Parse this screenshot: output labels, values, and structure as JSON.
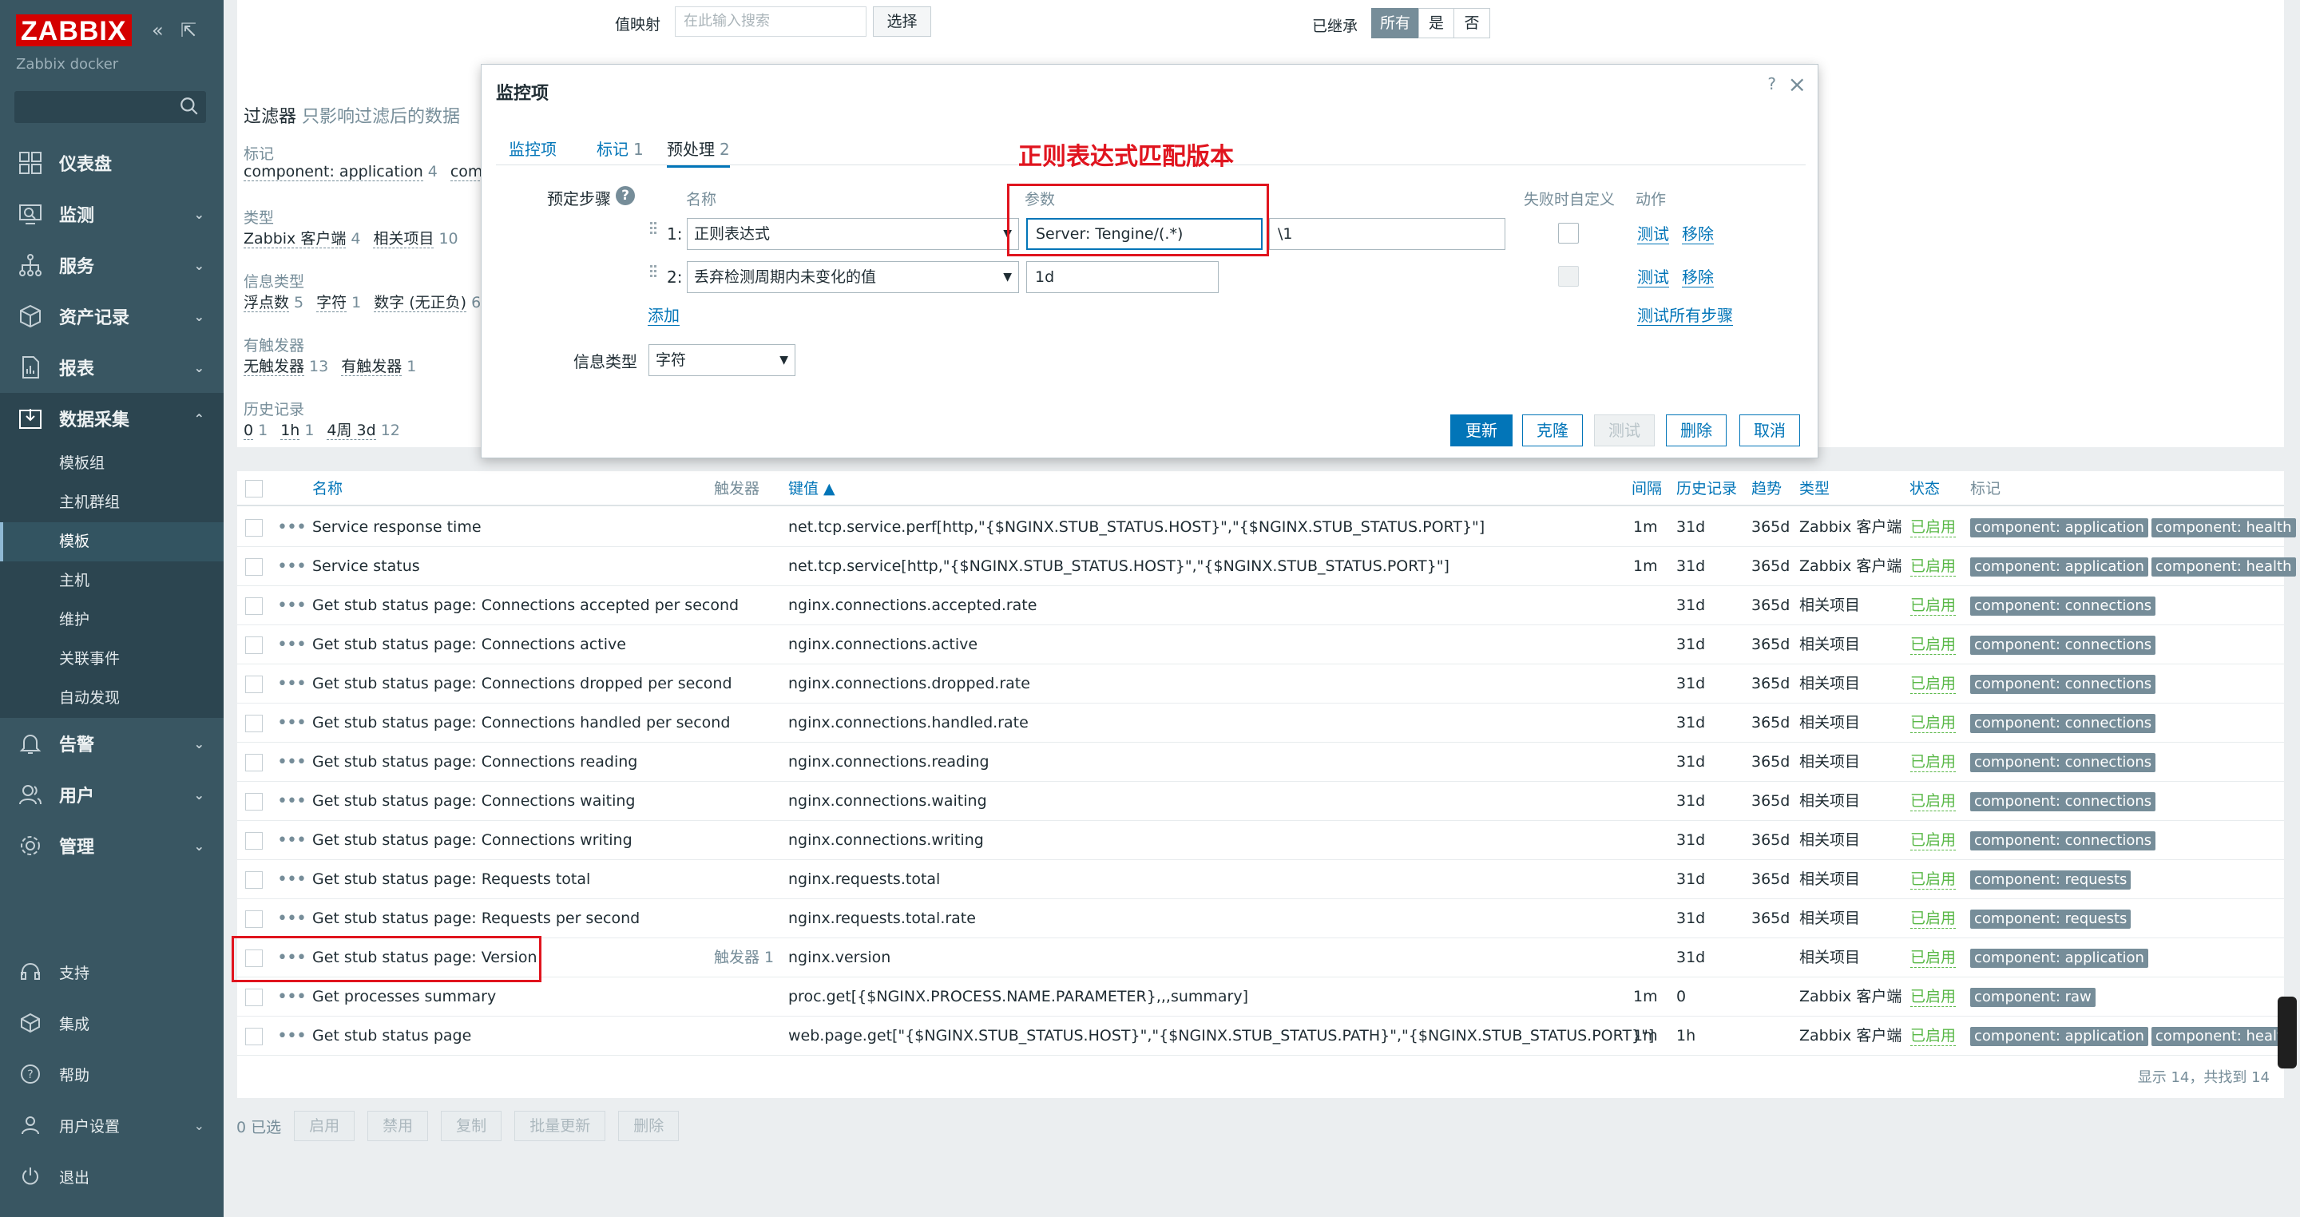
{
  "sidebar": {
    "logo": "ZABBIX",
    "instance": "Zabbix docker",
    "menu": [
      {
        "label": "仪表盘"
      },
      {
        "label": "监测"
      },
      {
        "label": "服务"
      },
      {
        "label": "资产记录"
      },
      {
        "label": "报表"
      },
      {
        "label": "数据采集"
      }
    ],
    "submenu": [
      "模板组",
      "主机群组",
      "模板",
      "主机",
      "维护",
      "关联事件",
      "自动发现"
    ],
    "menu2": [
      {
        "label": "告警"
      },
      {
        "label": "用户"
      },
      {
        "label": "管理"
      }
    ],
    "bottom": [
      {
        "label": "支持"
      },
      {
        "label": "集成"
      },
      {
        "label": "帮助"
      },
      {
        "label": "用户设置"
      },
      {
        "label": "退出"
      }
    ]
  },
  "filter": {
    "valuemap_label": "值映射",
    "valuemap_placeholder": "在此输入搜索",
    "select_btn": "选择",
    "inherited_label": "已继承",
    "inherited_options": [
      "所有",
      "是",
      "否"
    ],
    "title": "过滤器",
    "subtitle": "只影响过滤后的数据",
    "sections": [
      {
        "title": "标记",
        "values": [
          {
            "v": "component: application",
            "c": "4"
          },
          {
            "v": "compon",
            "c": ""
          }
        ]
      },
      {
        "title": "类型",
        "values": [
          {
            "v": "Zabbix 客户端",
            "c": "4"
          },
          {
            "v": "相关项目",
            "c": "10"
          }
        ]
      },
      {
        "title": "信息类型",
        "values": [
          {
            "v": "浮点数",
            "c": "5"
          },
          {
            "v": "字符",
            "c": "1"
          },
          {
            "v": "数字 (无正负)",
            "c": "6"
          }
        ]
      },
      {
        "title": "有触发器",
        "values": [
          {
            "v": "无触发器",
            "c": "13"
          },
          {
            "v": "有触发器",
            "c": "1"
          }
        ]
      },
      {
        "title": "历史记录",
        "values": [
          {
            "v": "0",
            "c": "1"
          },
          {
            "v": "1h",
            "c": "1"
          },
          {
            "v": "4周 3d",
            "c": "12"
          }
        ]
      }
    ]
  },
  "table": {
    "headers": {
      "name": "名称",
      "triggers": "触发器",
      "key": "键值 ▲",
      "interval": "间隔",
      "history": "历史记录",
      "trends": "趋势",
      "type": "类型",
      "status": "状态",
      "tags": "标记"
    },
    "rows": [
      {
        "name": "Service response time",
        "prefix": "",
        "triggers": "",
        "key": "net.tcp.service.perf[http,\"{$NGINX.STUB_STATUS.HOST}\",\"{$NGINX.STUB_STATUS.PORT}\"]",
        "interval": "1m",
        "history": "31d",
        "trends": "365d",
        "type": "Zabbix 客户端",
        "status": "已启用",
        "tags": [
          "component: application",
          "component: health"
        ]
      },
      {
        "name": "Service status",
        "prefix": "",
        "triggers": "",
        "key": "net.tcp.service[http,\"{$NGINX.STUB_STATUS.HOST}\",\"{$NGINX.STUB_STATUS.PORT}\"]",
        "interval": "1m",
        "history": "31d",
        "trends": "365d",
        "type": "Zabbix 客户端",
        "status": "已启用",
        "tags": [
          "component: application",
          "component: health"
        ]
      },
      {
        "name": "Connections accepted per second",
        "prefix": "Get stub status page: ",
        "triggers": "",
        "key": "nginx.connections.accepted.rate",
        "interval": "",
        "history": "31d",
        "trends": "365d",
        "type": "相关项目",
        "status": "已启用",
        "tags": [
          "component: connections"
        ]
      },
      {
        "name": "Connections active",
        "prefix": "Get stub status page: ",
        "triggers": "",
        "key": "nginx.connections.active",
        "interval": "",
        "history": "31d",
        "trends": "365d",
        "type": "相关项目",
        "status": "已启用",
        "tags": [
          "component: connections"
        ]
      },
      {
        "name": "Connections dropped per second",
        "prefix": "Get stub status page: ",
        "triggers": "",
        "key": "nginx.connections.dropped.rate",
        "interval": "",
        "history": "31d",
        "trends": "365d",
        "type": "相关项目",
        "status": "已启用",
        "tags": [
          "component: connections"
        ]
      },
      {
        "name": "Connections handled per second",
        "prefix": "Get stub status page: ",
        "triggers": "",
        "key": "nginx.connections.handled.rate",
        "interval": "",
        "history": "31d",
        "trends": "365d",
        "type": "相关项目",
        "status": "已启用",
        "tags": [
          "component: connections"
        ]
      },
      {
        "name": "Connections reading",
        "prefix": "Get stub status page: ",
        "triggers": "",
        "key": "nginx.connections.reading",
        "interval": "",
        "history": "31d",
        "trends": "365d",
        "type": "相关项目",
        "status": "已启用",
        "tags": [
          "component: connections"
        ]
      },
      {
        "name": "Connections waiting",
        "prefix": "Get stub status page: ",
        "triggers": "",
        "key": "nginx.connections.waiting",
        "interval": "",
        "history": "31d",
        "trends": "365d",
        "type": "相关项目",
        "status": "已启用",
        "tags": [
          "component: connections"
        ]
      },
      {
        "name": "Connections writing",
        "prefix": "Get stub status page: ",
        "triggers": "",
        "key": "nginx.connections.writing",
        "interval": "",
        "history": "31d",
        "trends": "365d",
        "type": "相关项目",
        "status": "已启用",
        "tags": [
          "component: connections"
        ]
      },
      {
        "name": "Requests total",
        "prefix": "Get stub status page: ",
        "triggers": "",
        "key": "nginx.requests.total",
        "interval": "",
        "history": "31d",
        "trends": "365d",
        "type": "相关项目",
        "status": "已启用",
        "tags": [
          "component: requests"
        ]
      },
      {
        "name": "Requests per second",
        "prefix": "Get stub status page: ",
        "triggers": "",
        "key": "nginx.requests.total.rate",
        "interval": "",
        "history": "31d",
        "trends": "365d",
        "type": "相关项目",
        "status": "已启用",
        "tags": [
          "component: requests"
        ]
      },
      {
        "name": "Version",
        "prefix": "Get stub status page: ",
        "triggers": "触发器 1",
        "key": "nginx.version",
        "interval": "",
        "history": "31d",
        "trends": "",
        "type": "相关项目",
        "status": "已启用",
        "tags": [
          "component: application"
        ]
      },
      {
        "name": "Get processes summary",
        "prefix": "",
        "triggers": "",
        "key": "proc.get[{$NGINX.PROCESS.NAME.PARAMETER},,,summary]",
        "interval": "1m",
        "history": "0",
        "trends": "",
        "type": "Zabbix 客户端",
        "status": "已启用",
        "tags": [
          "component: raw"
        ]
      },
      {
        "name": "Get stub status page",
        "prefix": "",
        "triggers": "",
        "key": "web.page.get[\"{$NGINX.STUB_STATUS.HOST}\",\"{$NGINX.STUB_STATUS.PATH}\",\"{$NGINX.STUB_STATUS.PORT}\"]",
        "interval": "1m",
        "history": "1h",
        "trends": "",
        "type": "Zabbix 客户端",
        "status": "已启用",
        "tags": [
          "component: application",
          "component: health"
        ]
      }
    ],
    "footer": "显示 14，共找到 14"
  },
  "massbar": {
    "selected": "0 已选",
    "buttons": [
      "启用",
      "禁用",
      "复制",
      "批量更新",
      "删除"
    ]
  },
  "dialog": {
    "title": "监控项",
    "help": "?",
    "close": "×",
    "tabs": [
      {
        "label": "监控项",
        "n": ""
      },
      {
        "label": "标记",
        "n": "1"
      },
      {
        "label": "预处理",
        "n": "2"
      }
    ],
    "steps_label": "预定步骤",
    "col_name": "名称",
    "col_params": "参数",
    "col_custom": "失败时自定义",
    "col_action": "动作",
    "steps": [
      {
        "num": "1:",
        "name": "正则表达式",
        "param1": "Server: Tengine/(.*)",
        "param2": "\\1",
        "test": "测试",
        "remove": "移除"
      },
      {
        "num": "2:",
        "name": "丢弃检测周期内未变化的值",
        "param1": "1d",
        "param2": "",
        "test": "测试",
        "remove": "移除"
      }
    ],
    "add": "添加",
    "test_all": "测试所有步骤",
    "infotype_label": "信息类型",
    "infotype_value": "字符",
    "buttons": {
      "update": "更新",
      "clone": "克隆",
      "test": "测试",
      "delete": "删除",
      "cancel": "取消"
    }
  },
  "annotation": "正则表达式匹配版本",
  "colors": {
    "sidebar": "#395662",
    "accent": "#0275b8",
    "annotation": "#e0141e",
    "enabled": "#59b847"
  }
}
